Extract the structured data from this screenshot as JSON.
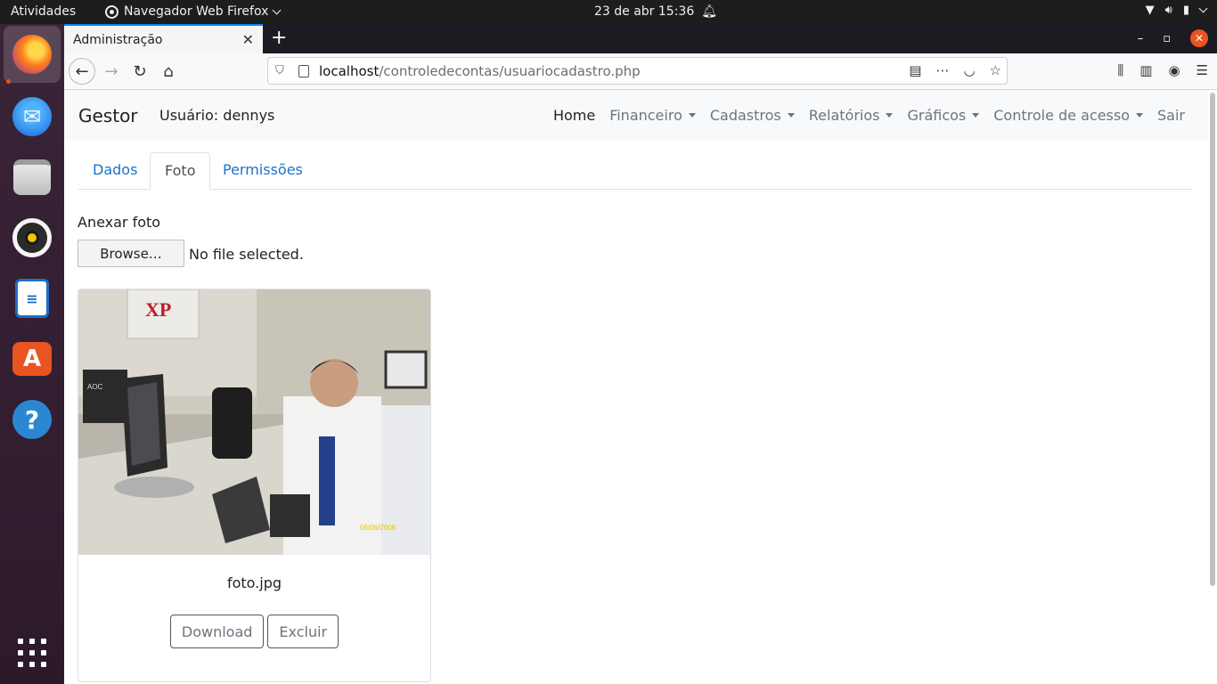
{
  "system_bar": {
    "activities": "Atividades",
    "app_menu": "Navegador Web Firefox",
    "clock": "23 de abr  15:36"
  },
  "browser": {
    "tab_title": "Administração",
    "url_host": "localhost",
    "url_path": "/controledecontas/usuariocadastro.php"
  },
  "site": {
    "brand": "Gestor",
    "user_label": "Usuário: dennys",
    "menu": [
      {
        "label": "Home",
        "dropdown": false
      },
      {
        "label": "Financeiro",
        "dropdown": true
      },
      {
        "label": "Cadastros",
        "dropdown": true
      },
      {
        "label": "Relatórios",
        "dropdown": true
      },
      {
        "label": "Gráficos",
        "dropdown": true
      },
      {
        "label": "Controle de acesso",
        "dropdown": true
      },
      {
        "label": "Sair",
        "dropdown": false
      }
    ]
  },
  "tabs": [
    {
      "label": "Dados",
      "active": false
    },
    {
      "label": "Foto",
      "active": true
    },
    {
      "label": "Permissões",
      "active": false
    }
  ],
  "photo_form": {
    "label": "Anexar foto",
    "browse_label": "Browse…",
    "no_file_text": "No file selected."
  },
  "photo_card": {
    "filename": "foto.jpg",
    "photo_date_stamp": "06/06/2008",
    "download_label": "Download",
    "delete_label": "Excluir"
  },
  "colors": {
    "accent_link": "#1a73c8",
    "ubuntu_orange": "#e95420"
  }
}
